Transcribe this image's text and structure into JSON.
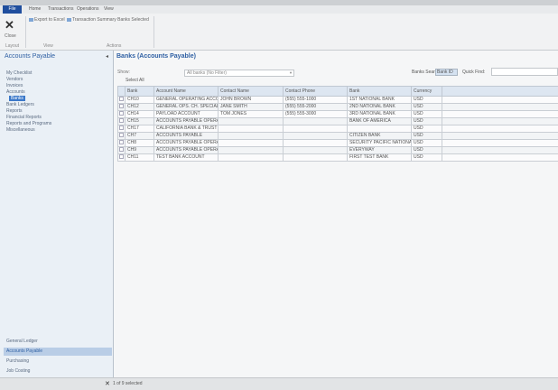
{
  "menubar": {
    "file_label": "File",
    "tabs": [
      "Home",
      "Transactions",
      "Operations",
      "View"
    ]
  },
  "ribbon": {
    "close_label": "Close",
    "buttons": [
      "Export to Excel",
      "Transaction Summary Banks Selected"
    ],
    "group_labels": [
      "Layout",
      "View",
      "Actions"
    ]
  },
  "left_panel": {
    "title": "Accounts Payable",
    "items": [
      "My Checklist",
      "Vendors",
      "Invoices",
      "Accounts",
      "Bank Ledgers",
      "Reports",
      "Financial Reports",
      "Reports and Programs",
      "Miscellaneous"
    ],
    "selected_item": "Banks"
  },
  "nav_buttons": [
    "General Ledger",
    "Accounts Payable",
    "Purchasing",
    "Job Costing"
  ],
  "content": {
    "title": "Banks (Accounts Payable)",
    "filter_label": "Show:",
    "filter_value": "All banks (No Filter)",
    "select_all_label": "Select All",
    "search_label": "Banks Search:",
    "search_value": "Bank ID",
    "quick_find_label": "Quick Find:",
    "quick_find_value": ""
  },
  "grid": {
    "columns": [
      "Bank",
      "Account Name",
      "Contact Name",
      "Contact Phone",
      "Bank",
      "Currency"
    ],
    "rows": [
      [
        "CH10",
        "GENERAL OPERATING ACCOUNT",
        "JOHN BROWN",
        "(555) 555-1000",
        "1ST NATIONAL BANK",
        "USD"
      ],
      [
        "CH12",
        "GENERAL OPS. CH. SPECIAL PMT",
        "JANE SMITH",
        "(555) 555-2000",
        "2ND NATIONAL BANK",
        "USD"
      ],
      [
        "CH14",
        "PAYLOAD ACCOUNT",
        "TOM JONES",
        "(555) 555-3000",
        "3RD NATIONAL BANK",
        "USD"
      ],
      [
        "CH15",
        "ACCOUNTS PAYABLE OPERATIONS",
        "",
        "",
        "BANK OF AMERICA",
        "USD"
      ],
      [
        "CH17",
        "CALIFORNIA BANK & TRUST",
        "",
        "",
        "",
        "USD"
      ],
      [
        "CH7",
        "ACCOUNTS PAYABLE",
        "",
        "",
        "CITIZEN BANK",
        "USD"
      ],
      [
        "CH8",
        "ACCOUNTS PAYABLE OPERATIONS",
        "",
        "",
        "SECURITY PACIFIC NATIONAL BANK",
        "USD"
      ],
      [
        "CH9",
        "ACCOUNTS PAYABLE OPERATIONS",
        "",
        "",
        "EVERYWAY",
        "USD"
      ],
      [
        "CH11",
        "TEST BANK ACCOUNT",
        "",
        "",
        "FIRST TEST BANK",
        "USD"
      ]
    ]
  },
  "status": {
    "text": "1 of 9 selected"
  }
}
